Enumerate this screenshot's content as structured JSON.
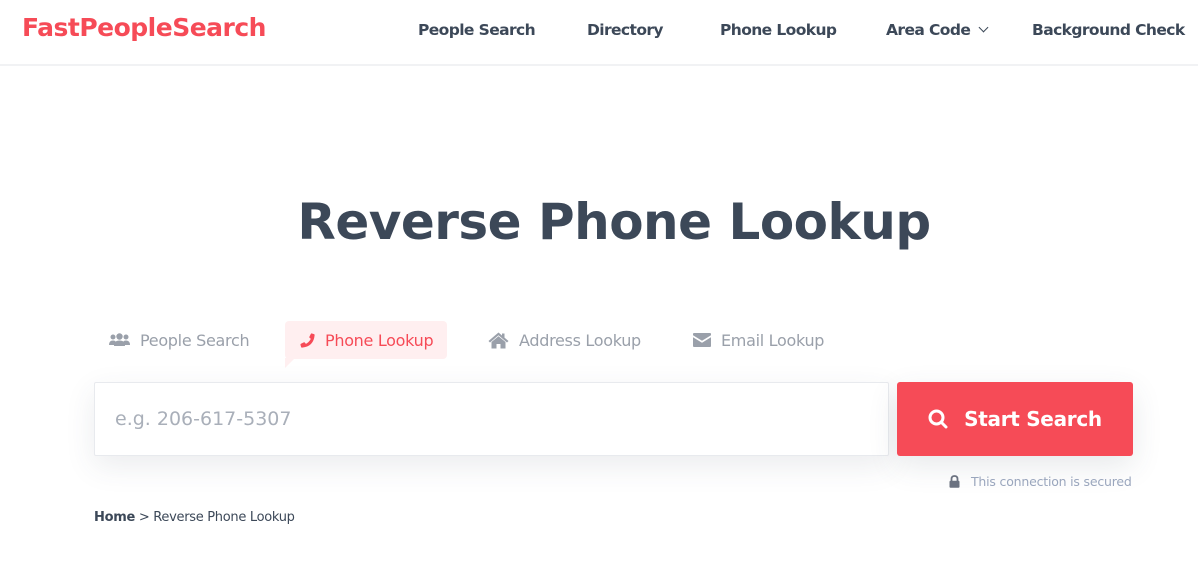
{
  "header": {
    "logo": "FastPeopleSearch",
    "nav": [
      {
        "label": "People Search"
      },
      {
        "label": "Directory"
      },
      {
        "label": "Phone Lookup"
      },
      {
        "label": "Area Code",
        "icon": "chevron-down-icon"
      },
      {
        "label": "Background Check"
      }
    ]
  },
  "main": {
    "title": "Reverse Phone Lookup",
    "tabs": [
      {
        "label": "People Search",
        "icon": "users-icon",
        "active": false
      },
      {
        "label": "Phone Lookup",
        "icon": "phone-icon",
        "active": true
      },
      {
        "label": "Address Lookup",
        "icon": "home-icon",
        "active": false
      },
      {
        "label": "Email Lookup",
        "icon": "envelope-icon",
        "active": false
      }
    ],
    "search": {
      "value": "",
      "placeholder": "e.g. 206-617-5307",
      "button_label": "Start Search",
      "button_icon": "search-icon"
    },
    "secure_text": "This connection is secured",
    "breadcrumb": {
      "home": "Home",
      "separator": ">",
      "current": "Reverse Phone Lookup"
    }
  },
  "colors": {
    "brand": "#f64b57",
    "text": "#3c4858",
    "muted": "#9aa0aa",
    "active_tab_bg": "#ffeff0"
  }
}
